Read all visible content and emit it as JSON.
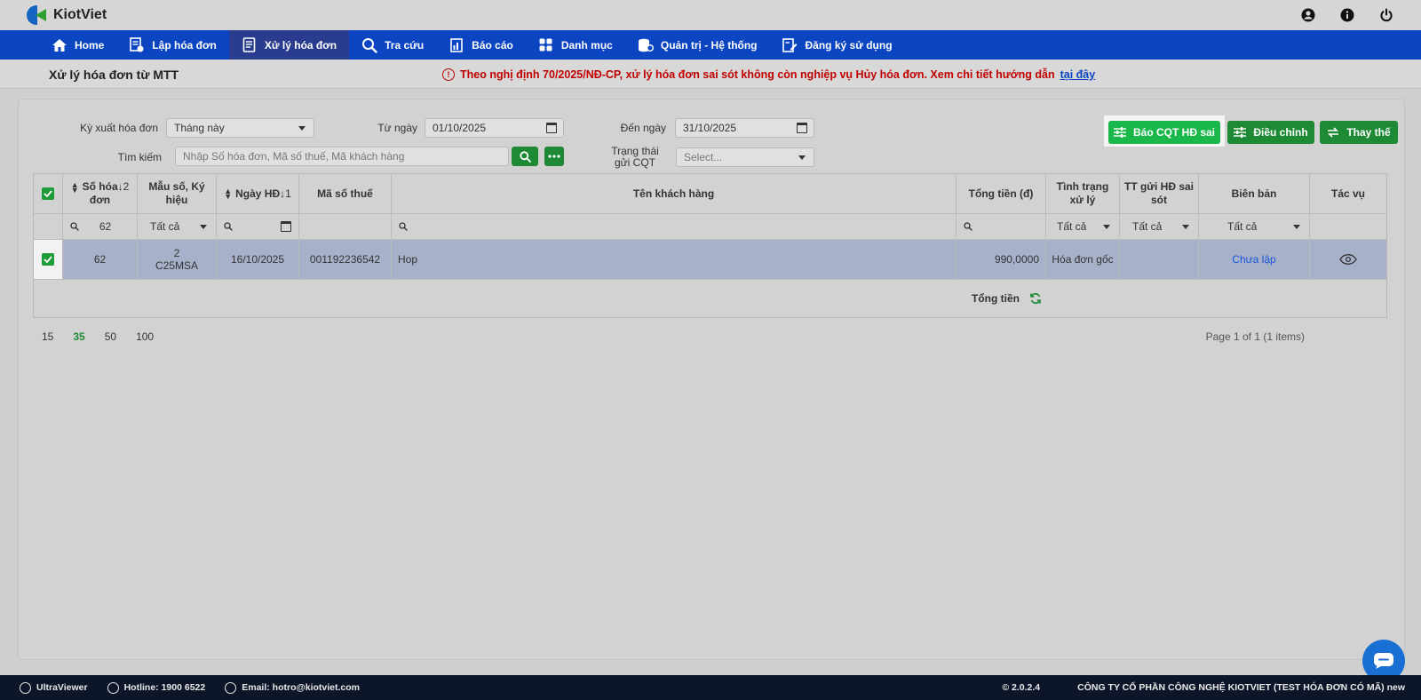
{
  "app": {
    "logo_text": "KiotViet"
  },
  "top_icons": [
    "user-icon",
    "info-icon",
    "power-icon"
  ],
  "nav": [
    {
      "label": "Home",
      "icon": "home-icon",
      "active": false
    },
    {
      "label": "Lập hóa đơn",
      "icon": "invoice-create-icon",
      "active": false
    },
    {
      "label": "Xử lý hóa đơn",
      "icon": "invoice-process-icon",
      "active": true
    },
    {
      "label": "Tra cứu",
      "icon": "search-icon",
      "active": false
    },
    {
      "label": "Báo cáo",
      "icon": "report-icon",
      "active": false
    },
    {
      "label": "Danh mục",
      "icon": "grid-icon",
      "active": false
    },
    {
      "label": "Quản trị - Hệ thống",
      "icon": "admin-icon",
      "active": false
    },
    {
      "label": "Đăng ký sử dụng",
      "icon": "register-icon",
      "active": false
    }
  ],
  "subheader": {
    "title": "Xử lý hóa đơn từ MTT",
    "notice": "Theo nghị định 70/2025/NĐ-CP, xử lý hóa đơn sai sót không còn nghiệp vụ Hủy hóa đơn. Xem chi tiết hướng dẫn",
    "notice_link": "tại đây"
  },
  "filters": {
    "period_label": "Kỳ xuất hóa đơn",
    "period_value": "Tháng này",
    "from_label": "Từ ngày",
    "from_value": "01/10/2025",
    "to_label": "Đến ngày",
    "to_value": "31/10/2025",
    "search_label": "Tìm kiếm",
    "search_placeholder": "Nhập Số hóa đơn, Mã số thuế, Mã khách hàng",
    "status_label_1": "Trạng thái",
    "status_label_2": "gửi CQT",
    "status_placeholder": "Select..."
  },
  "actions": {
    "report_wrong": "Báo CQT HĐ sai",
    "adjust": "Điều chỉnh",
    "replace": "Thay thế"
  },
  "table": {
    "headers": {
      "invoice_no_1": "Số hóa",
      "invoice_no_sort": "2",
      "invoice_no_2": "đơn",
      "form_1": "Mẫu số, Ký",
      "form_2": "hiệu",
      "date": "Ngày HĐ",
      "date_sort": "1",
      "tax_code": "Mã số thuế",
      "customer": "Tên khách hàng",
      "total": "Tổng tiền (đ)",
      "status_1": "Tình trạng",
      "status_2": "xử lý",
      "sent_1": "TT gửi HĐ sai",
      "sent_2": "sót",
      "minutes": "Biên bản",
      "actions": "Tác vụ"
    },
    "filters": {
      "invoice_no": "62",
      "form": "Tất cả",
      "status": "Tất cả",
      "sent": "Tất cả",
      "minutes": "Tất cả"
    },
    "rows": [
      {
        "invoice_no": "62",
        "form_no": "2",
        "symbol": "C25MSA",
        "date": "16/10/2025",
        "tax_code": "001192236542",
        "customer": "Hop",
        "total": "990,0000",
        "status": "Hóa đơn gốc",
        "sent": "",
        "minutes": "Chưa lập",
        "action_icon": "eye-icon"
      }
    ],
    "total_label": "Tổng tiền"
  },
  "pager": {
    "sizes": [
      "15",
      "35",
      "50",
      "100"
    ],
    "active_size": "35",
    "info": "Page 1 of 1 (1 items)"
  },
  "footer": {
    "ultraviewer": "UltraViewer",
    "hotline": "Hotline: 1900 6522",
    "email": "Email: hotro@kiotviet.com",
    "version": "© 2.0.2.4",
    "company": "CÔNG TY CỔ PHẦN CÔNG NGHỆ KIOTVIET (TEST HÓA ĐƠN CÓ MÃ) new"
  },
  "colors": {
    "nav": "#0b45c2",
    "nav_active": "#2a3c8e",
    "green": "#1e8a35",
    "bright_green": "#1ab84a",
    "selected_row": "#a7b2ca",
    "notice": "#c00000",
    "footer": "#0d1528"
  }
}
